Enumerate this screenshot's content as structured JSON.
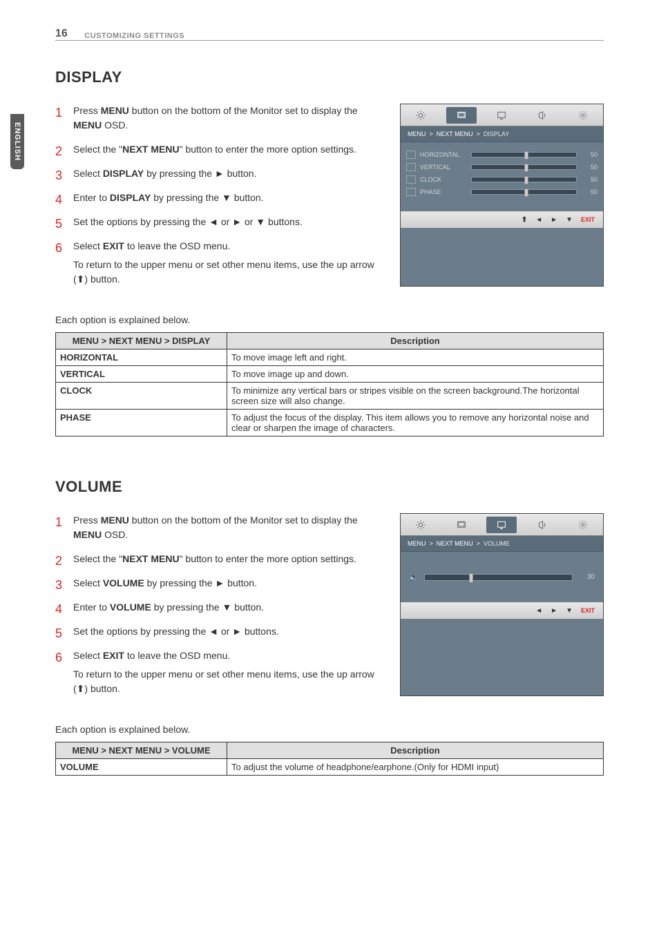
{
  "page": {
    "number": "16",
    "header": "CUSTOMIZING SETTINGS",
    "language_tab": "ENGLISH"
  },
  "display_section": {
    "title": "DISPLAY",
    "steps": [
      "Press MENU button on the bottom of the Monitor set to display the MENU OSD.",
      "Select the \"NEXT MENU\" button to enter the more option settings.",
      "Select DISPLAY by pressing the ► button.",
      "Enter to DISPLAY by pressing the ▼ button.",
      "Set the options by pressing the ◄ or ► or ▼ buttons.",
      "Select EXIT to leave the OSD menu."
    ],
    "return_note": "To return to the upper menu or set other menu items, use the up arrow (⬆) button.",
    "osd": {
      "breadcrumb": [
        "MENU",
        "NEXT MENU",
        "DISPLAY"
      ],
      "rows": [
        {
          "label": "HORIZONTAL",
          "value": "50",
          "fill": 50
        },
        {
          "label": "VERTICAL",
          "value": "50",
          "fill": 50
        },
        {
          "label": "CLOCK",
          "value": "50",
          "fill": 50
        },
        {
          "label": "PHASE",
          "value": "50",
          "fill": 50
        }
      ],
      "footer": {
        "exit": "EXIT"
      }
    },
    "explain_intro": "Each option is explained below.",
    "table": {
      "head_left": "MENU > NEXT MENU > DISPLAY",
      "head_right": "Description",
      "rows": [
        {
          "name": "HORIZONTAL",
          "desc": "To move image left and right."
        },
        {
          "name": "VERTICAL",
          "desc": "To move image up and down."
        },
        {
          "name": "CLOCK",
          "desc": "To minimize any vertical bars or stripes visible on the screen background.The horizontal screen size will also change."
        },
        {
          "name": "PHASE",
          "desc": "To adjust the focus of the display. This item allows you to remove any horizontal noise and clear or sharpen the image of characters."
        }
      ]
    }
  },
  "volume_section": {
    "title": "VOLUME",
    "steps": [
      "Press MENU button on the bottom of the Monitor set to display the MENU OSD.",
      "Select the \"NEXT MENU\" button to enter the more option settings.",
      "Select VOLUME by pressing the ► button.",
      "Enter to VOLUME by pressing the ▼ button.",
      "Set the options by pressing the ◄ or ► buttons.",
      "Select EXIT to leave the OSD menu."
    ],
    "return_note": "To return to the upper menu or set other menu items, use the up arrow (⬆) button.",
    "osd": {
      "breadcrumb": [
        "MENU",
        "NEXT MENU",
        "VOLUME"
      ],
      "value": "30",
      "fill": 30,
      "footer": {
        "exit": "EXIT"
      }
    },
    "explain_intro": "Each option is explained below.",
    "table": {
      "head_left": "MENU > NEXT MENU > VOLUME",
      "head_right": "Description",
      "rows": [
        {
          "name": "VOLUME",
          "desc": "To adjust the volume of headphone/earphone.(Only for HDMI input)"
        }
      ]
    }
  }
}
